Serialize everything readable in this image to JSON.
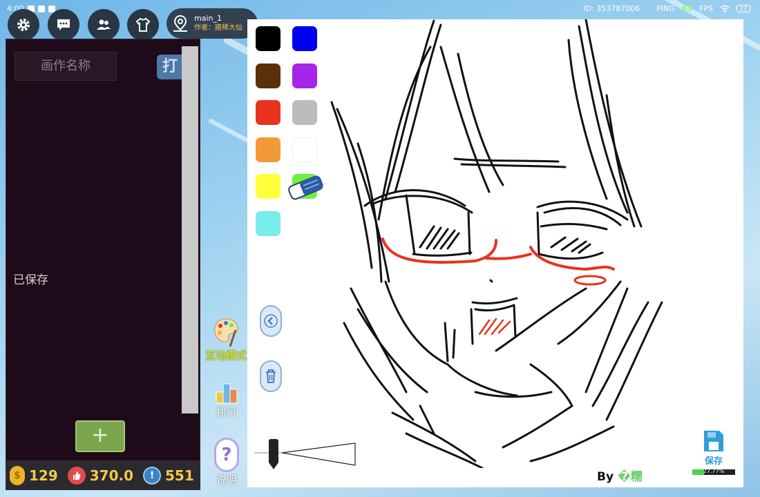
{
  "status_bar": {
    "time": "4:00",
    "id_text": "ID: 353787006",
    "ping_label": "PING",
    "ping_value": "63",
    "fps_label": "FPS",
    "battery": "27"
  },
  "top_nav": {
    "map_name": "main_1",
    "map_author": "作者：寤稀大仙"
  },
  "left_panel": {
    "name_placeholder": "画作名称",
    "open_button": "打",
    "saved_status": "已保存",
    "add_button": "+"
  },
  "currency": {
    "coins": "129",
    "likes": "370.0",
    "alerts": "551"
  },
  "side_tools": {
    "interact_mode": "互动模式",
    "ranking": "排行",
    "help": "说明"
  },
  "palette": {
    "colors": [
      "#000000",
      "#0000f0",
      "#5a300a",
      "#a525e8",
      "#e8321e",
      "#bcbcbc",
      "#f29a38",
      "#ffffff",
      "#ffff3c",
      "#6ef03c",
      "#78ecea"
    ]
  },
  "canvas": {
    "by_prefix": "By",
    "author_name": "�糯",
    "save_label": "保存",
    "save_progress_text": "27.77%",
    "save_progress": 0.2777
  }
}
